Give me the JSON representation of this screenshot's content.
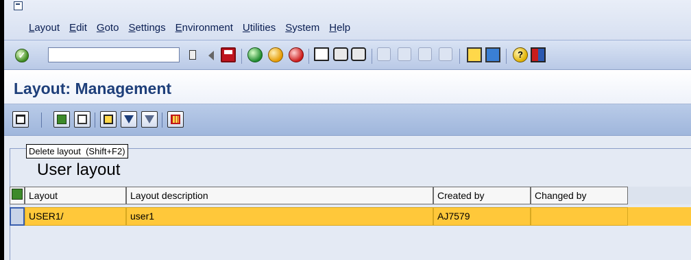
{
  "menu": {
    "items": [
      "Layout",
      "Edit",
      "Goto",
      "Settings",
      "Environment",
      "Utilities",
      "System",
      "Help"
    ]
  },
  "toolbar": {
    "command_value": "",
    "icons": [
      "enter-icon",
      "command-field",
      "back-arrow-icon",
      "save-icon",
      "back-icon",
      "exit-icon",
      "cancel-icon",
      "print-icon",
      "find-icon",
      "find-next-icon",
      "first-page-icon",
      "previous-page-icon",
      "next-page-icon",
      "last-page-icon",
      "create-session-icon",
      "shortcut-icon",
      "help-icon",
      "customize-layout-icon"
    ]
  },
  "title": "Layout: Management",
  "app_toolbar": {
    "buttons": [
      "delete-layout",
      "choose",
      "save-as",
      "print",
      "filter",
      "delete-filter",
      "change-layout"
    ]
  },
  "tooltip": "Delete layout  (Shift+F2)",
  "group": {
    "title": "User layout"
  },
  "table": {
    "columns": [
      "Layout",
      "Layout description",
      "Created by",
      "Changed by"
    ],
    "rows": [
      [
        "USER1/",
        "user1",
        "AJ7579",
        ""
      ]
    ]
  },
  "colors": {
    "title_text": "#1e3f7a",
    "selected_row": "#ffc83a",
    "toolbar_bg": "#b9cbe8"
  }
}
